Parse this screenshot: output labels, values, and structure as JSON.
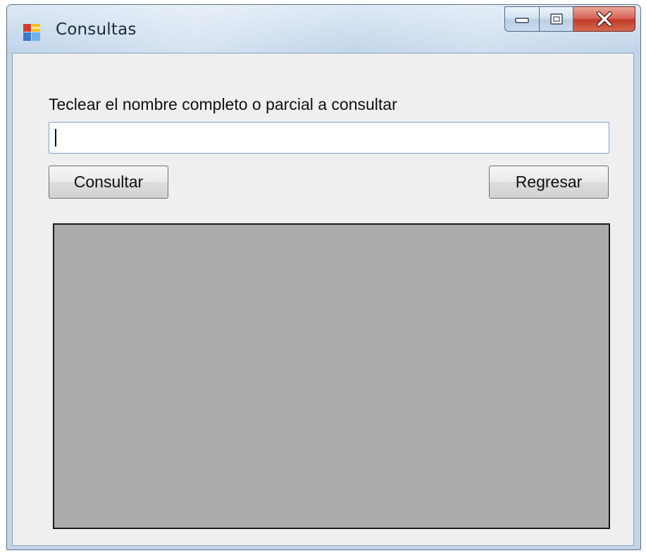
{
  "window": {
    "title": "Consultas",
    "icons": {
      "app": "form-app-icon",
      "minimize": "minimize-icon",
      "maximize": "maximize-icon",
      "close": "close-icon"
    }
  },
  "form": {
    "prompt_label": "Teclear el nombre completo o parcial a consultar",
    "search_value": "",
    "consult_button": "Consultar",
    "back_button": "Regresar"
  },
  "results": {
    "rows": []
  },
  "colors": {
    "form_background": "#efefef",
    "grid_background": "#ababab",
    "close_button": "#c8473a"
  }
}
